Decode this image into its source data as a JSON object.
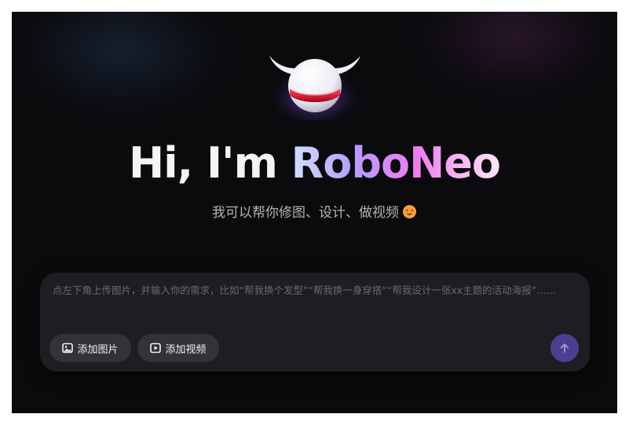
{
  "hero": {
    "title_prefix": "Hi, I'm ",
    "title_brand": "RoboNeo",
    "subtitle": "我可以帮你修图、设计、做视频",
    "emoji_icon": "starstruck-face-icon"
  },
  "chat": {
    "placeholder": "点左下角上传图片，并输入你的需求，比如“帮我换个发型”“帮我换一身穿搭”“帮我设计一张xx主题的活动海报”……",
    "value": "",
    "add_image_label": "添加图片",
    "add_video_label": "添加视频",
    "send_icon": "arrow-up-icon"
  },
  "colors": {
    "background": "#0b0b0d",
    "panel": "#1e1d22",
    "pill": "#333238",
    "send_button": "#4a3f93",
    "brand_gradient": [
      "#cfe0ff",
      "#b59cff",
      "#f07cf0",
      "#ffe8f8"
    ]
  }
}
